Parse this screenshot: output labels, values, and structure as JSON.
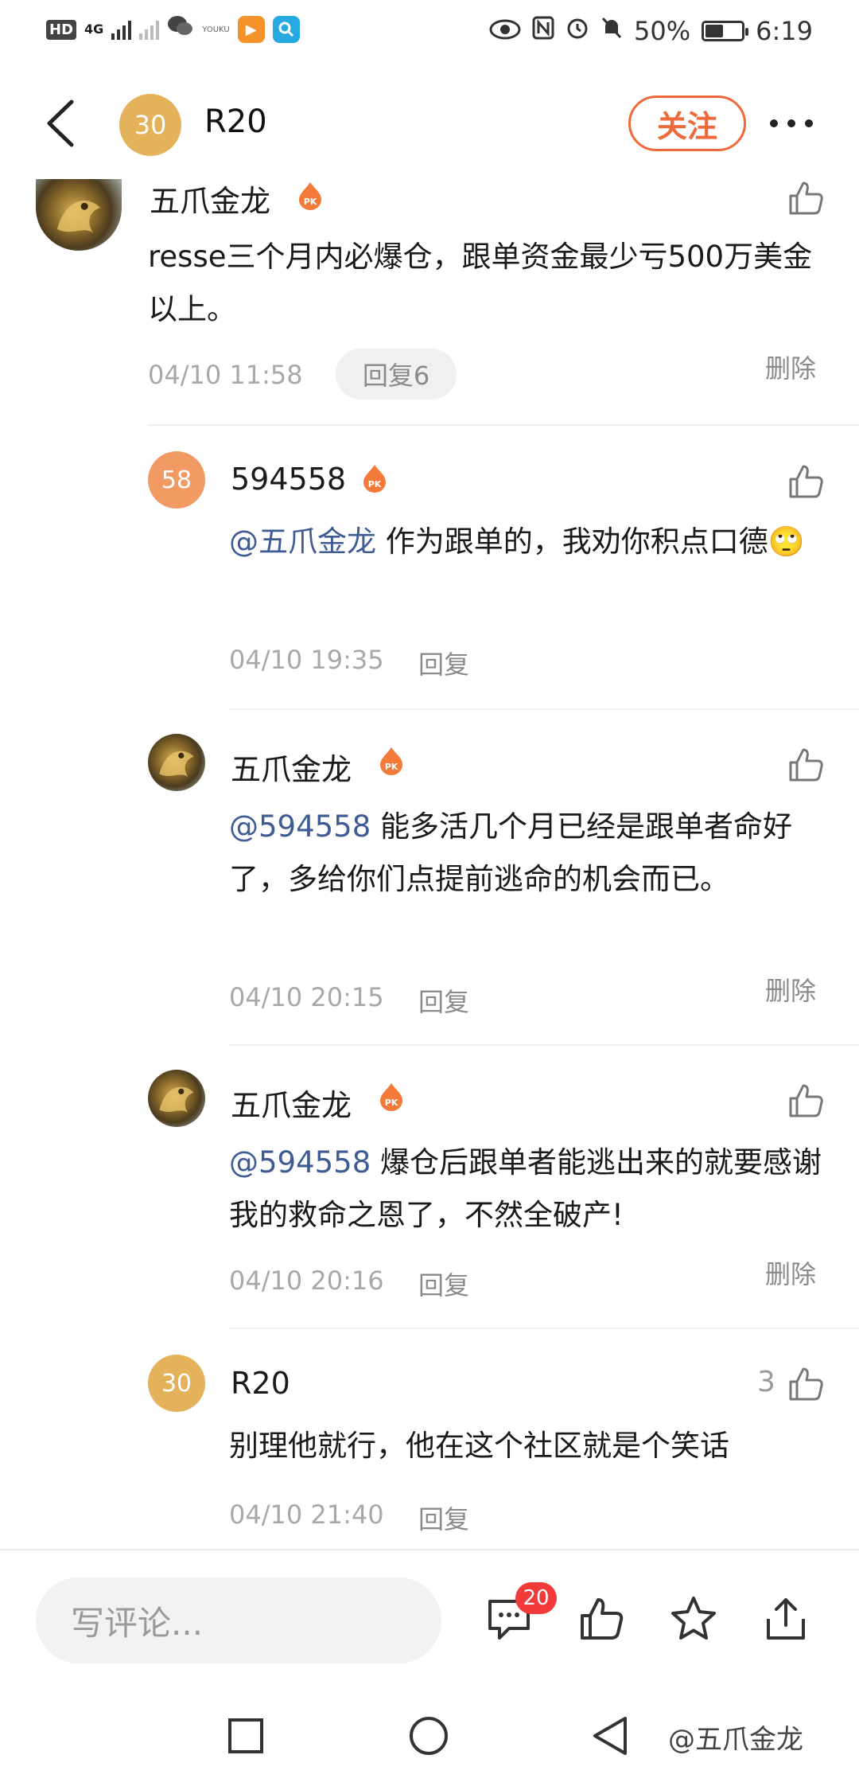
{
  "status_bar": {
    "hd": "HD",
    "network": "4G",
    "battery": "50%",
    "battery_level": 0.5,
    "time": "6:19",
    "app_youku": "YOUKU"
  },
  "header": {
    "avatar_text": "30",
    "avatar_color": "#e3b25b",
    "title": "R20",
    "follow_label": "关注",
    "accent_color": "#ef6a3b"
  },
  "main_comment": {
    "user": "五爪金龙",
    "text": "resse三个月内必爆仓，跟单资金最少亏500万美金以上。",
    "time": "04/10 11:58",
    "reply_label": "回复6",
    "delete_label": "删除"
  },
  "replies": [
    {
      "user": "594558",
      "avatar_text": "58",
      "avatar_color": "#f29a63",
      "mention": "@五爪金龙",
      "text": " 作为跟单的，我劝你积点口德🙄",
      "time": "04/10 19:35",
      "reply_label": "回复"
    },
    {
      "user": "五爪金龙",
      "mention": "@594558",
      "text": " 能多活几个月已经是跟单者命好了，多给你们点提前逃命的机会而已。",
      "time": "04/10 20:15",
      "reply_label": "回复",
      "delete_label": "删除"
    },
    {
      "user": "五爪金龙",
      "mention": "@594558",
      "text": " 爆仓后跟单者能逃出来的就要感谢我的救命之恩了，不然全破产!",
      "time": "04/10 20:16",
      "reply_label": "回复",
      "delete_label": "删除"
    },
    {
      "user": "R20",
      "avatar_text": "30",
      "avatar_color": "#e3b25b",
      "text": "别理他就行，他在这个社区就是个笑话",
      "time": "04/10 21:40",
      "reply_label": "回复",
      "like_count": "3"
    }
  ],
  "bottom_bar": {
    "input_placeholder": "写评论...",
    "comment_count": "20"
  },
  "watermark": "@五爪金龙"
}
